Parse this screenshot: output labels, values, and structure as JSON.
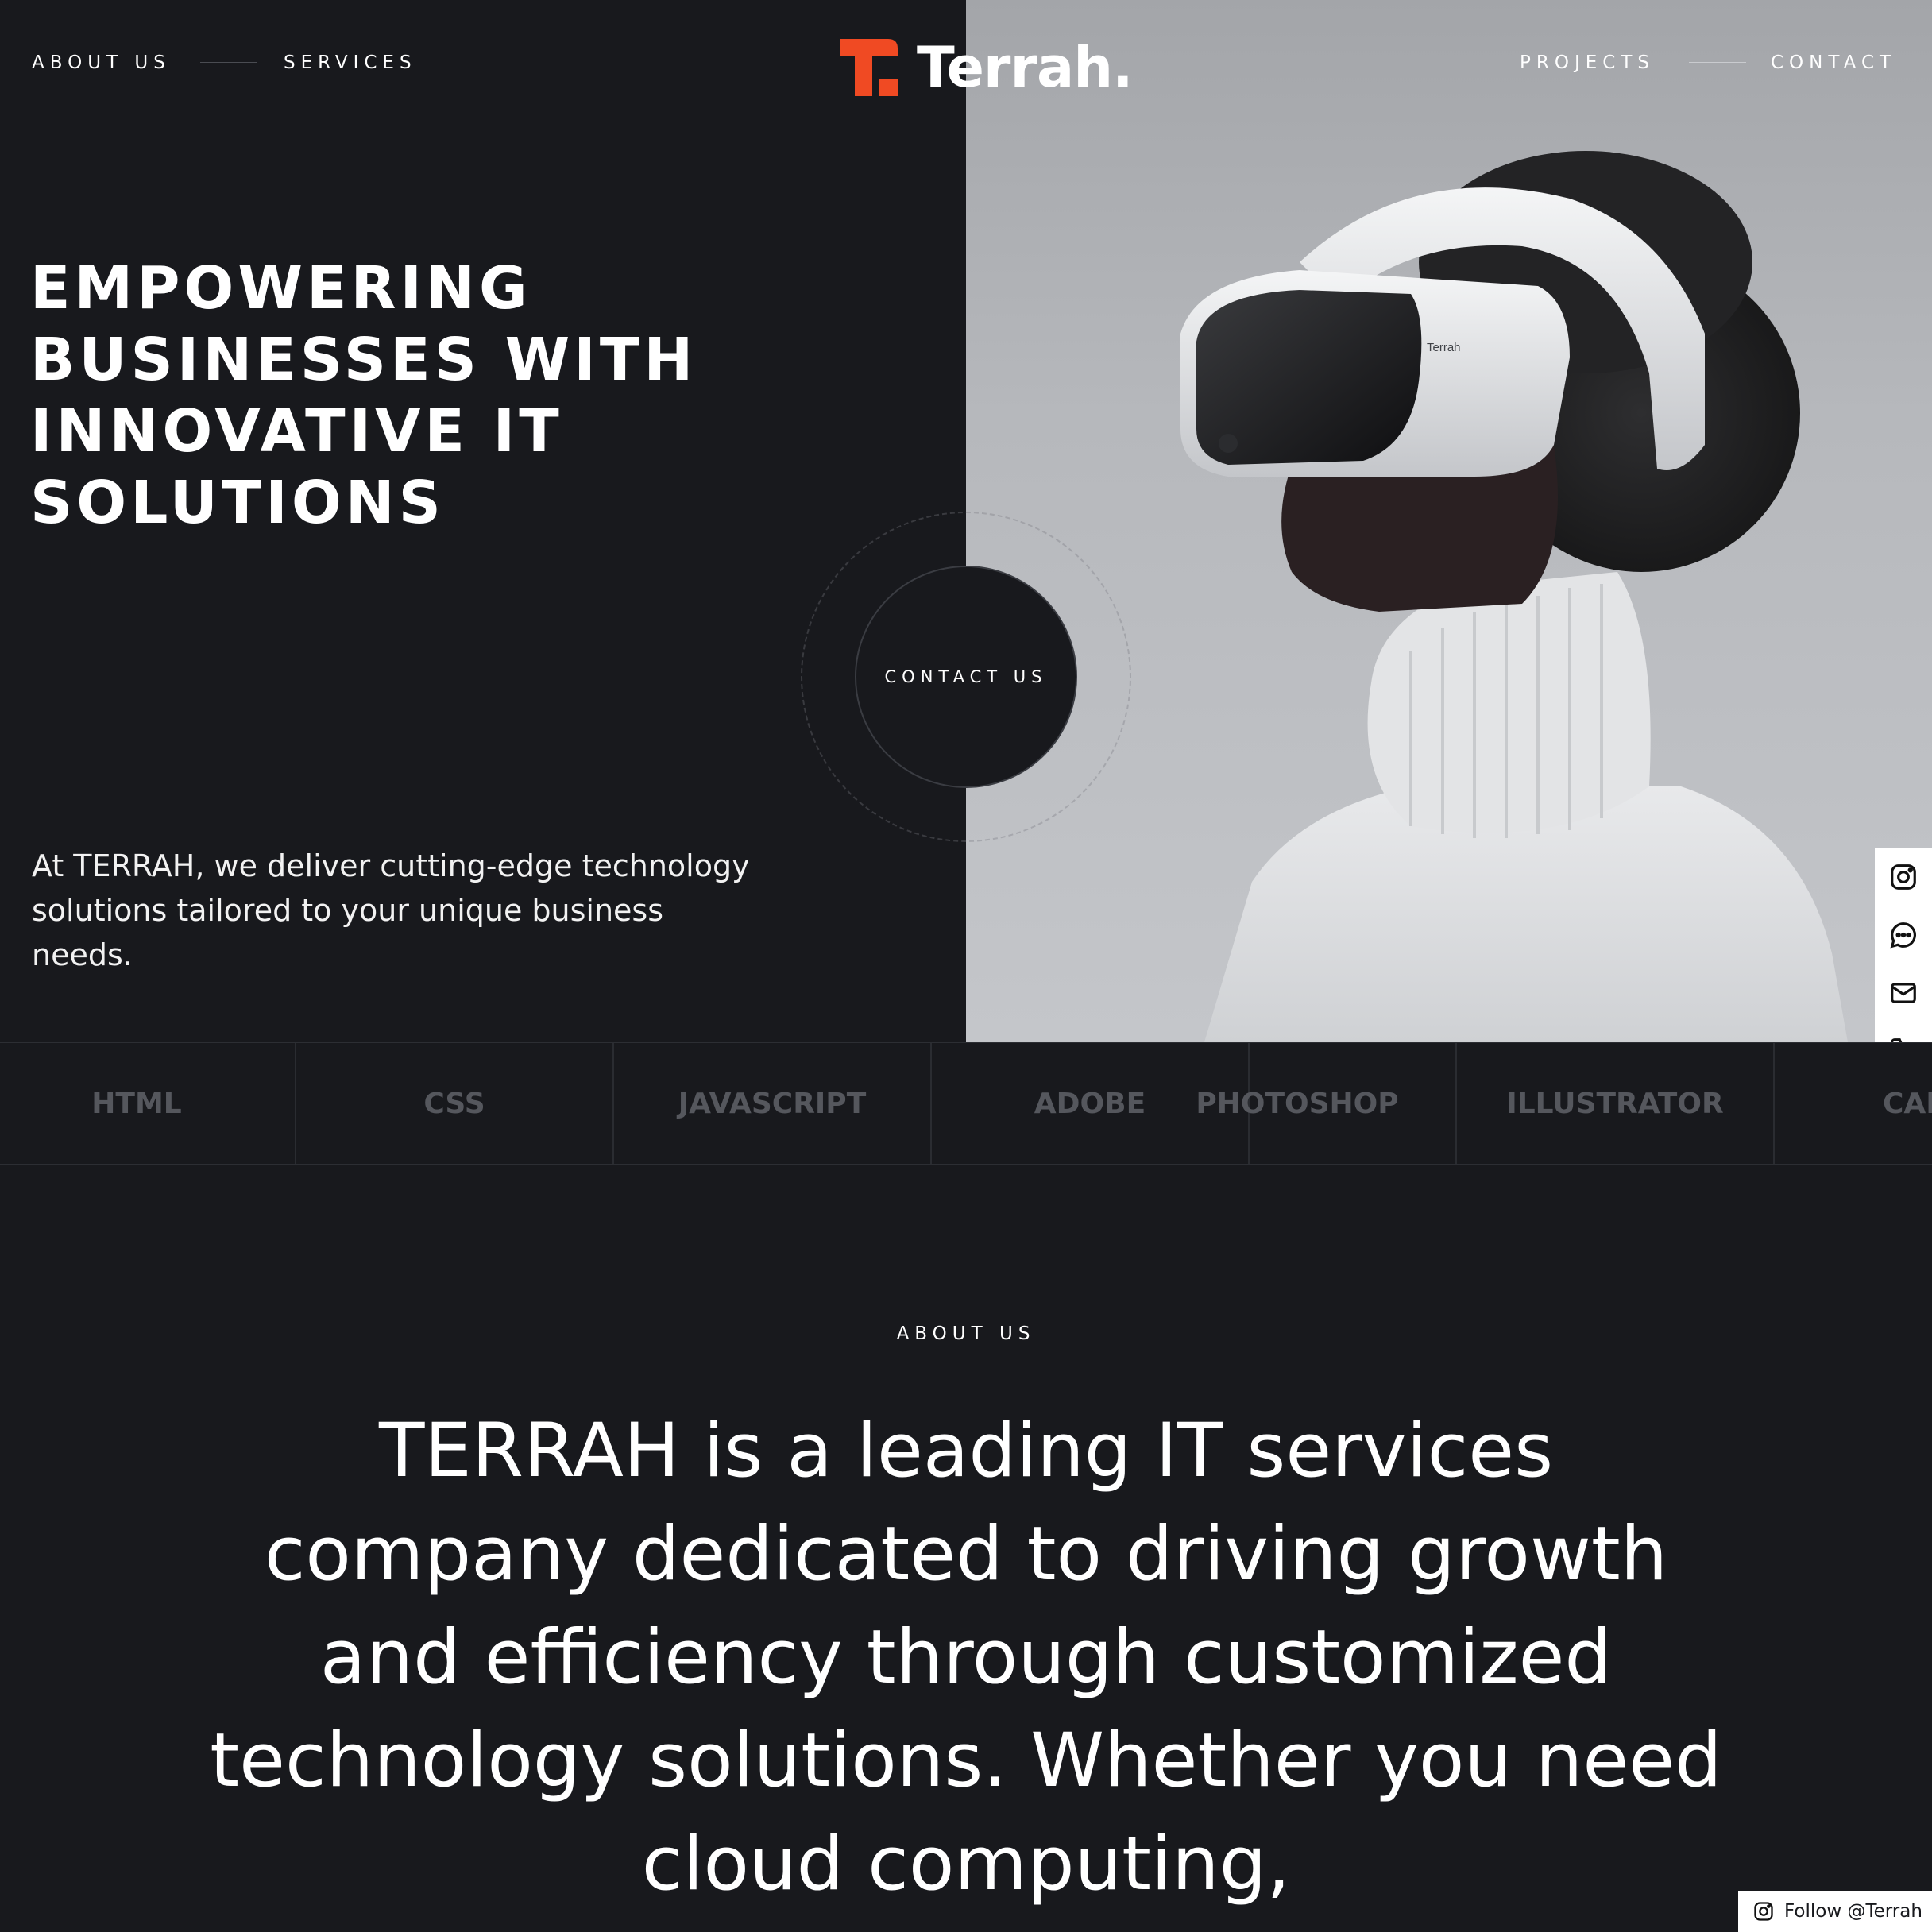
{
  "nav": {
    "left": [
      "ABOUT US",
      "SERVICES"
    ],
    "right": [
      "PROJECTS",
      "CONTACT"
    ]
  },
  "logo": {
    "text": "Terrah.",
    "accent_color": "#f04a23"
  },
  "hero": {
    "title_lines": [
      "EMPOWERING",
      "BUSINESSES WITH",
      "INNOVATIVE IT",
      "SOLUTIONS"
    ],
    "subtitle": "At TERRAH, we deliver cutting-edge technology solutions tailored to your unique business needs.",
    "cta": "CONTACT US",
    "photo_headset_label": "Terrah"
  },
  "marquee": {
    "items": [
      "HTML",
      "CSS",
      "JAVASCRIPT",
      "ADOBE",
      "PHOTOSHOP",
      "ILLUSTRATOR",
      "CANVA"
    ]
  },
  "social": {
    "icons": [
      "instagram-icon",
      "chat-icon",
      "mail-icon",
      "phone-icon"
    ]
  },
  "about": {
    "label": "ABOUT US",
    "text": "TERRAH is a leading IT services company dedicated to driving growth and efficiency through customized technology solutions. Whether you need cloud computing,"
  },
  "follow": {
    "label": "Follow @Terrah"
  },
  "colors": {
    "background": "#18191d",
    "accent": "#f04a23",
    "photo_bg": "#b4b6ba"
  }
}
